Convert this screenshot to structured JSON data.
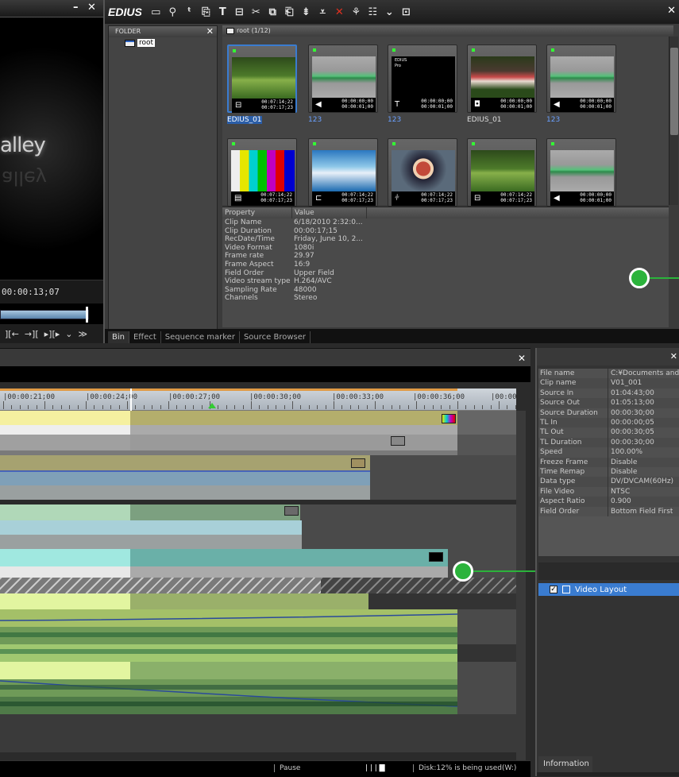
{
  "preview": {
    "overlay_text": "alley",
    "reflection_text": "alley",
    "timecode": "00:00:13;07",
    "controls": [
      "][←",
      "→][",
      "▸][▸",
      "⌄",
      "≫"
    ],
    "close": "✕",
    "minimize": "–"
  },
  "bin": {
    "logo": "EDIUS",
    "folder_header": "FOLDER",
    "folder_close": "✕",
    "folder_root": "root",
    "clip_header": "root (1/12)",
    "close": "✕",
    "clips": [
      {
        "label": "EDIUS_01",
        "tc1": "00:07:14;22",
        "tc2": "00:07:17;23",
        "type": "video",
        "selected": true
      },
      {
        "label": "123",
        "tc1": "00:00:00;00",
        "tc2": "00:00:01;00",
        "type": "audio"
      },
      {
        "label": "123",
        "tc1": "00:00:00;00",
        "tc2": "00:00:01;00",
        "type": "title",
        "thumbtext": "EDIUS\nPro"
      },
      {
        "label": "EDIUS_01",
        "tc1": "00:00:00;00",
        "tc2": "00:00:01;00",
        "type": "still"
      },
      {
        "label": "123",
        "tc1": "00:00:00;00",
        "tc2": "00:00:01;00",
        "type": "audio"
      },
      {
        "label": "",
        "tc1": "00:07:14;22",
        "tc2": "00:07:17;23",
        "type": "colorbars"
      },
      {
        "label": "",
        "tc1": "00:07:14;22",
        "tc2": "00:07:17;23",
        "type": "sequence"
      },
      {
        "label": "",
        "tc1": "00:07:14;22",
        "tc2": "00:07:17;23",
        "type": "subclip"
      },
      {
        "label": "",
        "tc1": "00:07:14;22",
        "tc2": "00:07:17;23",
        "type": "video"
      },
      {
        "label": "",
        "tc1": "00:00:00;00",
        "tc2": "00:00:01;00",
        "type": "audio"
      }
    ],
    "properties_header": {
      "property": "Property",
      "value": "Value"
    },
    "properties": [
      {
        "k": "Clip Name",
        "v": "6/18/2010 2:32:0..."
      },
      {
        "k": "Clip Duration",
        "v": "00:00:17;15"
      },
      {
        "k": "RecDate/Time",
        "v": "Friday, June 10, 2..."
      },
      {
        "k": "Video Format",
        "v": "1080i"
      },
      {
        "k": "Frame rate",
        "v": "29.97"
      },
      {
        "k": "Frame Aspect",
        "v": "16:9"
      },
      {
        "k": "Field Order",
        "v": "Upper Field"
      },
      {
        "k": "Video stream type",
        "v": "H.264/AVC"
      },
      {
        "k": "Sampling Rate",
        "v": "48000"
      },
      {
        "k": "Channels",
        "v": "Stereo"
      }
    ],
    "tabs": [
      "Bin",
      "Effect",
      "Sequence marker",
      "Source Browser"
    ]
  },
  "timeline": {
    "close": "✕",
    "ruler": [
      "|00:00:21;00",
      "|00:00:24;00",
      "|00:00:27;00",
      "|00:00:30;00",
      "|00:00:33;00",
      "|00:00:36;00",
      "|00:00"
    ],
    "status": {
      "pause": "Pause",
      "disk": "Disk:12% is being used(W:)"
    }
  },
  "info": {
    "close": "✕",
    "rows": [
      {
        "k": "File name",
        "v": "C:¥Documents and"
      },
      {
        "k": "Clip name",
        "v": "V01_001"
      },
      {
        "k": "Source In",
        "v": "01:04:43;00"
      },
      {
        "k": "Source Out",
        "v": "01:05:13;00"
      },
      {
        "k": "Source Duration",
        "v": "00:00:30;00"
      },
      {
        "k": "TL In",
        "v": "00:00:00;05"
      },
      {
        "k": "TL Out",
        "v": "00:00:30;05"
      },
      {
        "k": "TL Duration",
        "v": "00:00:30;00"
      },
      {
        "k": "Speed",
        "v": "100.00%"
      },
      {
        "k": "Freeze Frame",
        "v": "Disable"
      },
      {
        "k": "Time Remap",
        "v": "Disable"
      },
      {
        "k": "Data type",
        "v": "DV/DVCAM(60Hz)"
      },
      {
        "k": "File Video Standard",
        "v": "NTSC"
      },
      {
        "k": "Aspect Ratio",
        "v": "0.900"
      },
      {
        "k": "Field Order",
        "v": "Bottom Field First"
      }
    ],
    "layer_item": "Video Layout",
    "tab": "Information"
  }
}
